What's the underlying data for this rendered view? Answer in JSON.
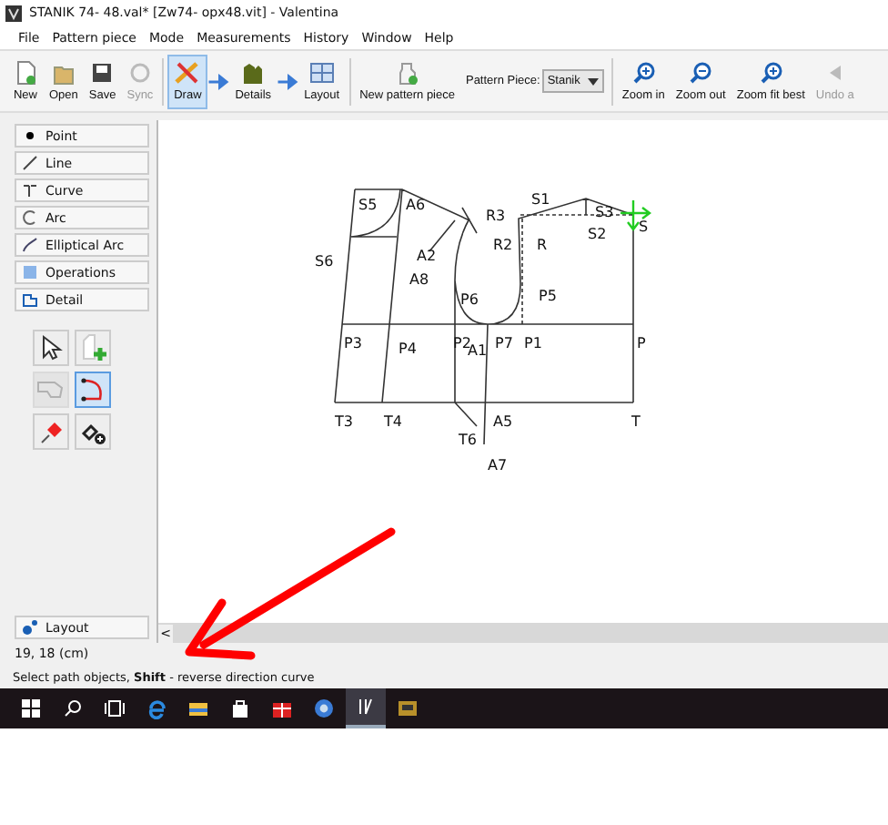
{
  "window": {
    "title": "STANIK 74- 48.val* [Zw74- opx48.vit] - Valentina"
  },
  "menu": [
    "File",
    "Pattern piece",
    "Mode",
    "Measurements",
    "History",
    "Window",
    "Help"
  ],
  "toolbar": {
    "file_buttons": [
      {
        "label": "New",
        "disabled": false
      },
      {
        "label": "Open",
        "disabled": false
      },
      {
        "label": "Save",
        "disabled": false
      },
      {
        "label": "Sync",
        "disabled": true
      }
    ],
    "modes": [
      {
        "label": "Draw",
        "selected": true
      },
      {
        "label": "Details",
        "selected": false
      },
      {
        "label": "Layout",
        "selected": false
      }
    ],
    "new_piece": "New pattern piece",
    "piece_label": "Pattern Piece:",
    "piece_value": "Stanik",
    "zoom_buttons": [
      {
        "label": "Zoom in",
        "disabled": false
      },
      {
        "label": "Zoom out",
        "disabled": false
      },
      {
        "label": "Zoom fit best",
        "disabled": false
      },
      {
        "label": "Undo a",
        "disabled": true
      }
    ]
  },
  "sidebar": {
    "groups": [
      "Point",
      "Line",
      "Curve",
      "Arc",
      "Elliptical Arc",
      "Operations",
      "Detail"
    ],
    "tools": [
      {
        "selected": false,
        "disabled": false
      },
      {
        "selected": false,
        "disabled": false
      },
      {
        "selected": false,
        "disabled": true
      },
      {
        "selected": true,
        "disabled": false
      },
      {
        "selected": false,
        "disabled": false
      },
      {
        "selected": false,
        "disabled": false
      }
    ],
    "layout_button": "Layout"
  },
  "canvas": {
    "points": [
      "S5",
      "A6",
      "S6",
      "A2",
      "A8",
      "R3",
      "S1",
      "S3",
      "S2",
      "S",
      "R2",
      "R",
      "P6",
      "P5",
      "P3",
      "P4",
      "P2",
      "A1",
      "P7",
      "P1",
      "P",
      "T3",
      "T4",
      "T6",
      "A5",
      "T",
      "A7"
    ],
    "scroll_left": "<"
  },
  "status_bar": {
    "coordinates": "19, 18 (cm)",
    "message": "Select path objects, **Shift** - reverse direction curve"
  },
  "taskbar": [
    {
      "selected": false
    },
    {
      "selected": false
    },
    {
      "selected": false
    },
    {
      "selected": false
    },
    {
      "selected": false
    },
    {
      "selected": false
    },
    {
      "selected": false
    },
    {
      "selected": false
    },
    {
      "selected": true
    },
    {
      "selected": false
    }
  ]
}
